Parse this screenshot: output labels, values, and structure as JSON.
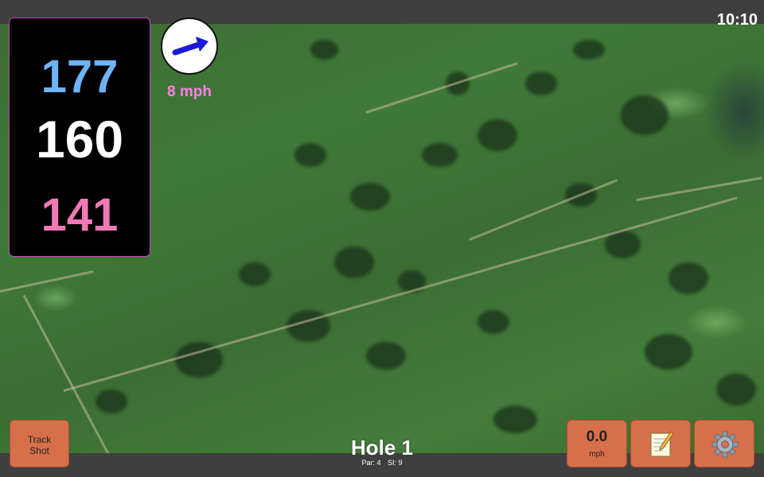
{
  "status": {
    "time": "10:10"
  },
  "distances": {
    "back": "177",
    "middle": "160",
    "front": "141"
  },
  "wind": {
    "speed_label": "8 mph",
    "direction_icon": "wind-arrow-icon"
  },
  "hole": {
    "title": "Hole 1",
    "par_label": "Par: 4",
    "si_label": "SI: 9"
  },
  "buttons": {
    "track_shot": "Track\nShot",
    "speed_value": "0.0",
    "speed_unit": "mph",
    "notes_icon": "notepad-icon",
    "settings_icon": "gear-icon"
  },
  "colors": {
    "back_distance": "#6eb4f6",
    "middle_distance": "#ffffff",
    "front_distance": "#f17ab6",
    "wind_text": "#ff7fe8",
    "button_bg": "#d7704a",
    "bar_bg": "#3f3f3f"
  }
}
